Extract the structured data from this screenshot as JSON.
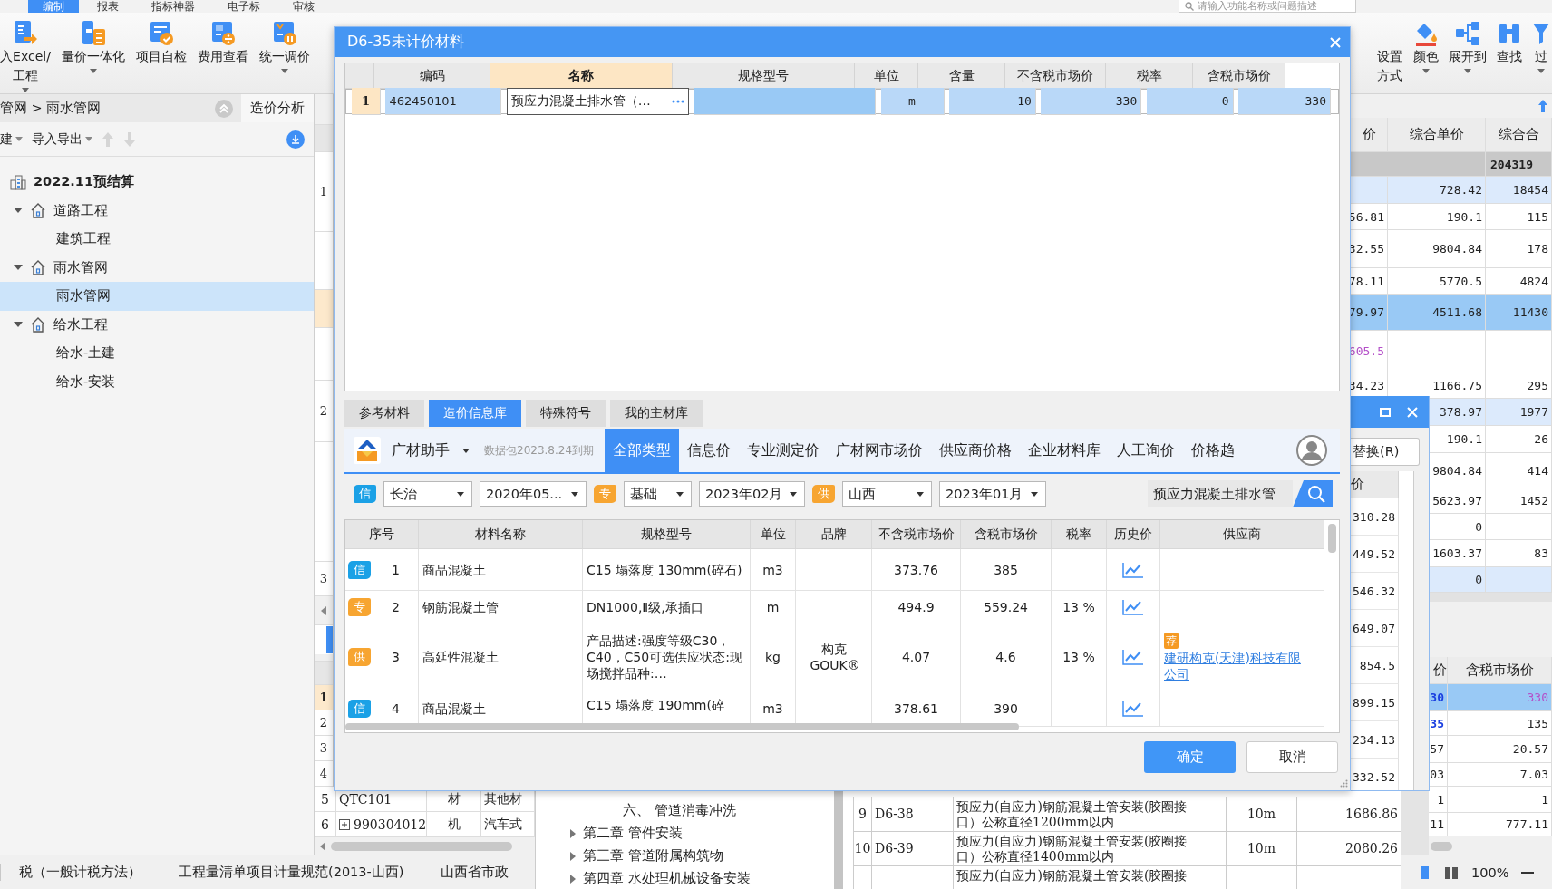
{
  "menu_bar": {
    "tabs": [
      {
        "label": "编制",
        "selected": true
      },
      {
        "label": "报表",
        "selected": false
      },
      {
        "label": "指标神器",
        "selected": false
      },
      {
        "label": "电子标",
        "selected": false
      },
      {
        "label": "审核",
        "selected": false
      }
    ],
    "search": {
      "placeholder": "请输入功能名称或问题描述"
    }
  },
  "ribbon": {
    "left": [
      {
        "label": "入Excel/工程",
        "caret": true
      },
      {
        "label": "量价一体化",
        "caret": true
      },
      {
        "label": "项目自检",
        "caret": false
      },
      {
        "label": "费用查看",
        "caret": false
      },
      {
        "label": "统一调价",
        "caret": true
      }
    ],
    "right": [
      {
        "label": "设置方式",
        "caret": false
      },
      {
        "label": "颜色",
        "caret": true
      },
      {
        "label": "展开到",
        "caret": true
      },
      {
        "label": "查找",
        "caret": false
      },
      {
        "label": "过",
        "caret": true
      }
    ]
  },
  "left_panel": {
    "breadcrumb": "管网 > 雨水管网",
    "side_tab": "造价分析",
    "toolbar": [
      {
        "label": "建",
        "caret": true
      },
      {
        "label": "导入导出",
        "caret": true
      }
    ],
    "tree": {
      "label": "2022.11预结算",
      "children": [
        {
          "label": "道路工程",
          "expanded": true,
          "selected": false,
          "children": [
            {
              "label": "建筑工程",
              "selected": false
            }
          ]
        },
        {
          "label": "雨水管网",
          "expanded": true,
          "selected": false,
          "children": [
            {
              "label": "雨水管网",
              "selected": true
            }
          ]
        },
        {
          "label": "给水工程",
          "expanded": true,
          "selected": false,
          "children": [
            {
              "label": "给水-土建",
              "selected": false
            },
            {
              "label": "给水-安装",
              "selected": false
            }
          ]
        }
      ]
    }
  },
  "center_grid": {
    "upper_rows": [
      "1",
      "2",
      "3"
    ],
    "lower_rows": [
      {
        "number": "1",
        "selected": true
      },
      {
        "number": "2",
        "selected": false
      },
      {
        "number": "3",
        "selected": false
      },
      {
        "number": "4",
        "selected": false
      }
    ]
  },
  "lower_grid": {
    "rows": [
      {
        "number": "5",
        "code": "QTC101",
        "type": "材",
        "name": "其他材",
        "expandable": false
      },
      {
        "number": "6",
        "code": "990304012",
        "type": "机",
        "name": "汽车式",
        "expandable": true
      }
    ]
  },
  "chapter_tree": {
    "items": [
      {
        "children": [
          {
            "label": "六、 管道消毒冲洗"
          }
        ]
      },
      {
        "label": "第二章 管件安装",
        "expanded": false
      },
      {
        "label": "第三章 管道附属构筑物",
        "expanded": false
      },
      {
        "label": "第四章 水处理机械设备安装",
        "expanded": false
      }
    ]
  },
  "quota_grid": {
    "rows": [
      {
        "number": "9",
        "code": "D6-38",
        "description": "预应力(自应力)钢筋混凝土管安装(胶圈接口）公称直径1200mm以内",
        "unit": "10m",
        "amount": "1686.86"
      },
      {
        "number": "10",
        "code": "D6-39",
        "description": "预应力(自应力)钢筋混凝土管安装(胶圈接口）公称直径1400mm以内",
        "unit": "10m",
        "amount": "2080.26"
      },
      {
        "description": "预应力(自应力)钢筋混凝土管安装(胶圈接"
      }
    ]
  },
  "right_grid": {
    "columns": [
      "价",
      "综合单价",
      "综合合"
    ],
    "total": "204319",
    "rows": [
      {
        "unit_price": "728.42",
        "total_price": "18454",
        "selected": false,
        "highlighted": true
      },
      {
        "column_1": "56.81",
        "unit_price": "190.1",
        "total_price": "115",
        "selected": false,
        "highlighted": false
      },
      {
        "column_1": "32.55",
        "unit_price": "9804.84",
        "total_price": "178",
        "selected": false,
        "highlighted": false
      },
      {
        "column_1": "78.11",
        "unit_price": "5770.5",
        "total_price": "4824",
        "selected": false,
        "highlighted": false
      },
      {
        "column_1": "79.97",
        "unit_price": "4511.68",
        "total_price": "11430",
        "selected": true
      },
      {
        "column_1": "605.5",
        "kind": "material",
        "selected": false,
        "highlighted": false
      },
      {
        "column_1": "34.23",
        "unit_price": "1166.75",
        "total_price": "295",
        "selected": false,
        "highlighted": false
      },
      {
        "unit_price": "378.97",
        "total_price": "1977",
        "selected": false,
        "highlighted": true
      },
      {
        "unit_price": "190.1",
        "total_price": "26",
        "selected": false,
        "highlighted": false
      },
      {
        "unit_price": "9804.84",
        "total_price": "414",
        "selected": false,
        "highlighted": false
      },
      {
        "unit_price": "5623.97",
        "total_price": "1452",
        "selected": false,
        "highlighted": false
      },
      {
        "unit_price": "0",
        "selected": false,
        "highlighted": false
      },
      {
        "unit_price": "1603.37",
        "total_price": "83",
        "selected": false,
        "highlighted": false
      },
      {
        "unit_price": "0",
        "selected": false,
        "highlighted": true
      }
    ]
  },
  "material_grid": {
    "columns": [
      "价",
      "含税市场价"
    ],
    "rows": [
      {
        "column_1": "30",
        "market_price": "330",
        "selected": true,
        "kind": "adjusted"
      },
      {
        "column_1": "35",
        "market_price": "135",
        "selected": false,
        "kind": "emphasis"
      },
      {
        "column_1": "57",
        "market_price": "20.57",
        "selected": false,
        "kind": "plain"
      },
      {
        "column_1": "03",
        "market_price": "7.03",
        "selected": false,
        "kind": "plain"
      },
      {
        "column_1": "1",
        "market_price": "1",
        "selected": false,
        "kind": "plain"
      },
      {
        "column_1": "11",
        "market_price": "777.11",
        "selected": false,
        "kind": "plain"
      }
    ]
  },
  "replace_dialog": {
    "button": "替换(R)",
    "column": "价",
    "values": [
      "310.28",
      "449.52",
      "546.32",
      "649.07",
      "854.5",
      "899.15",
      "234.13",
      "332.52"
    ]
  },
  "dialog": {
    "title": "D6-35未计价材料",
    "columns": [
      "编码",
      "名称",
      "规格型号",
      "单位",
      "含量",
      "不含税市场价",
      "税率",
      "含税市场价"
    ],
    "rows": [
      {
        "number": "1",
        "code": "462450101",
        "name": "预应力混凝土排水管（…",
        "unit": "m",
        "quantity": "10",
        "price_ex_tax": "330",
        "tax_rate": "0",
        "price_inc_tax": "330",
        "selected": true
      }
    ],
    "tabs": [
      {
        "label": "参考材料",
        "selected": false
      },
      {
        "label": "造价信息库",
        "selected": true
      },
      {
        "label": "特殊符号",
        "selected": false
      },
      {
        "label": "我的主材库",
        "selected": false
      }
    ],
    "assistant": {
      "name": "广材助手",
      "notice": "数据包2023.8.24到期",
      "tabs": [
        {
          "label": "全部类型",
          "selected": true
        },
        {
          "label": "信息价",
          "selected": false
        },
        {
          "label": "专业测定价",
          "selected": false
        },
        {
          "label": "广材网市场价",
          "selected": false
        },
        {
          "label": "供应商价格",
          "selected": false
        },
        {
          "label": "企业材料库",
          "selected": false
        },
        {
          "label": "人工询价",
          "selected": false
        },
        {
          "label": "价格趋",
          "selected": false
        }
      ]
    },
    "filters": [
      {
        "kind": "badge",
        "text": "信",
        "color": "#1ba1e6"
      },
      {
        "kind": "select",
        "value": "长治"
      },
      {
        "kind": "select",
        "value": "2020年05..."
      },
      {
        "kind": "badge",
        "text": "专",
        "color": "#f7a531"
      },
      {
        "kind": "select",
        "value": "基础"
      },
      {
        "kind": "select",
        "value": "2023年02月"
      },
      {
        "kind": "badge",
        "text": "供",
        "color": "#f7a531"
      },
      {
        "kind": "select",
        "value": "山西"
      },
      {
        "kind": "select",
        "value": "2023年01月"
      }
    ],
    "search": {
      "value": "预应力混凝土排水管"
    },
    "table": {
      "columns": [
        "序号",
        "材料名称",
        "规格型号",
        "单位",
        "品牌",
        "不含税市场价",
        "含税市场价",
        "税率",
        "历史价",
        "供应商"
      ],
      "rows": [
        {
          "source": {
            "text": "信",
            "color": "#1ba1e6"
          },
          "number": "1",
          "name": "商品混凝土",
          "spec": "C15 塌落度 130mm(碎石)",
          "unit": "m3",
          "price_ex_tax": "373.76",
          "price_inc_tax": "385"
        },
        {
          "source": {
            "text": "专",
            "color": "#f7a531"
          },
          "number": "2",
          "name": "钢筋混凝土管",
          "spec": "DN1000,Ⅱ级,承插口",
          "unit": "m",
          "price_ex_tax": "494.9",
          "price_inc_tax": "559.24",
          "tax_rate": "13 %"
        },
        {
          "source": {
            "text": "供",
            "color": "#f7a531"
          },
          "number": "3",
          "name": "高延性混凝土",
          "spec": "产品描述:强度等级C30，C40，C50可选供应状态:现场搅拌品种:…",
          "unit": "kg",
          "brand": "构克GOUK®",
          "price_ex_tax": "4.07",
          "price_inc_tax": "4.6",
          "tax_rate": "13 %",
          "supplier": {
            "tag": "荐",
            "name": "建研构克(天津)科技有限公司"
          }
        },
        {
          "source": {
            "text": "信",
            "color": "#1ba1e6"
          },
          "number": "4",
          "name": "商品混凝土",
          "spec": "C15 塌落度 190mm(碎",
          "unit": "m3",
          "price_ex_tax": "378.61",
          "price_inc_tax": "390"
        }
      ]
    },
    "buttons": [
      {
        "label": "确定",
        "kind": "primary"
      },
      {
        "label": "取消",
        "kind": "secondary"
      }
    ]
  },
  "status_bar": {
    "items": [
      "税（一般计税方法）",
      "工程量清单项目计量规范(2013-山西)",
      "山西省市政"
    ],
    "zoom": "100%"
  }
}
